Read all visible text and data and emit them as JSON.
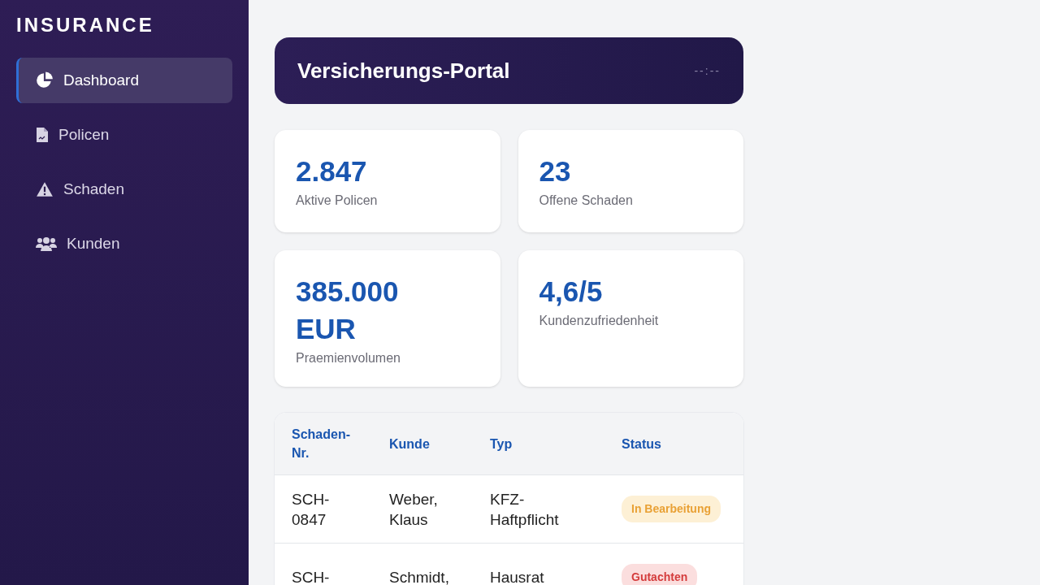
{
  "brand": "INSURANCE",
  "nav": [
    {
      "label": "Dashboard",
      "kind": "chart",
      "selected": true
    },
    {
      "label": "Policen",
      "kind": "doc",
      "selected": false
    },
    {
      "label": "Schaden",
      "kind": "warning",
      "selected": false
    },
    {
      "label": "Kunden",
      "kind": "users",
      "selected": false
    }
  ],
  "header": {
    "title": "Versicherungs-Portal",
    "clock": "--:--"
  },
  "stats": [
    {
      "value": "2.847",
      "label": "Aktive Policen"
    },
    {
      "value": "23",
      "label": "Offene Schaden"
    },
    {
      "value": "385.000 EUR",
      "label": "Praemienvolumen"
    },
    {
      "value": "4,6/5",
      "label": "Kundenzufriedenheit"
    }
  ],
  "table": {
    "columns": [
      "Schaden-Nr.",
      "Kunde",
      "Typ",
      "Status"
    ],
    "rows": [
      {
        "id": "SCH-0847",
        "customer": "Weber, Klaus",
        "type": "KFZ-Haftpflicht",
        "status": "In Bearbeitung",
        "kind": "progress"
      },
      {
        "id": "SCH-",
        "customer": "Schmidt,",
        "type": "Hausrat",
        "status": "Gutachten",
        "kind": "review"
      }
    ]
  }
}
